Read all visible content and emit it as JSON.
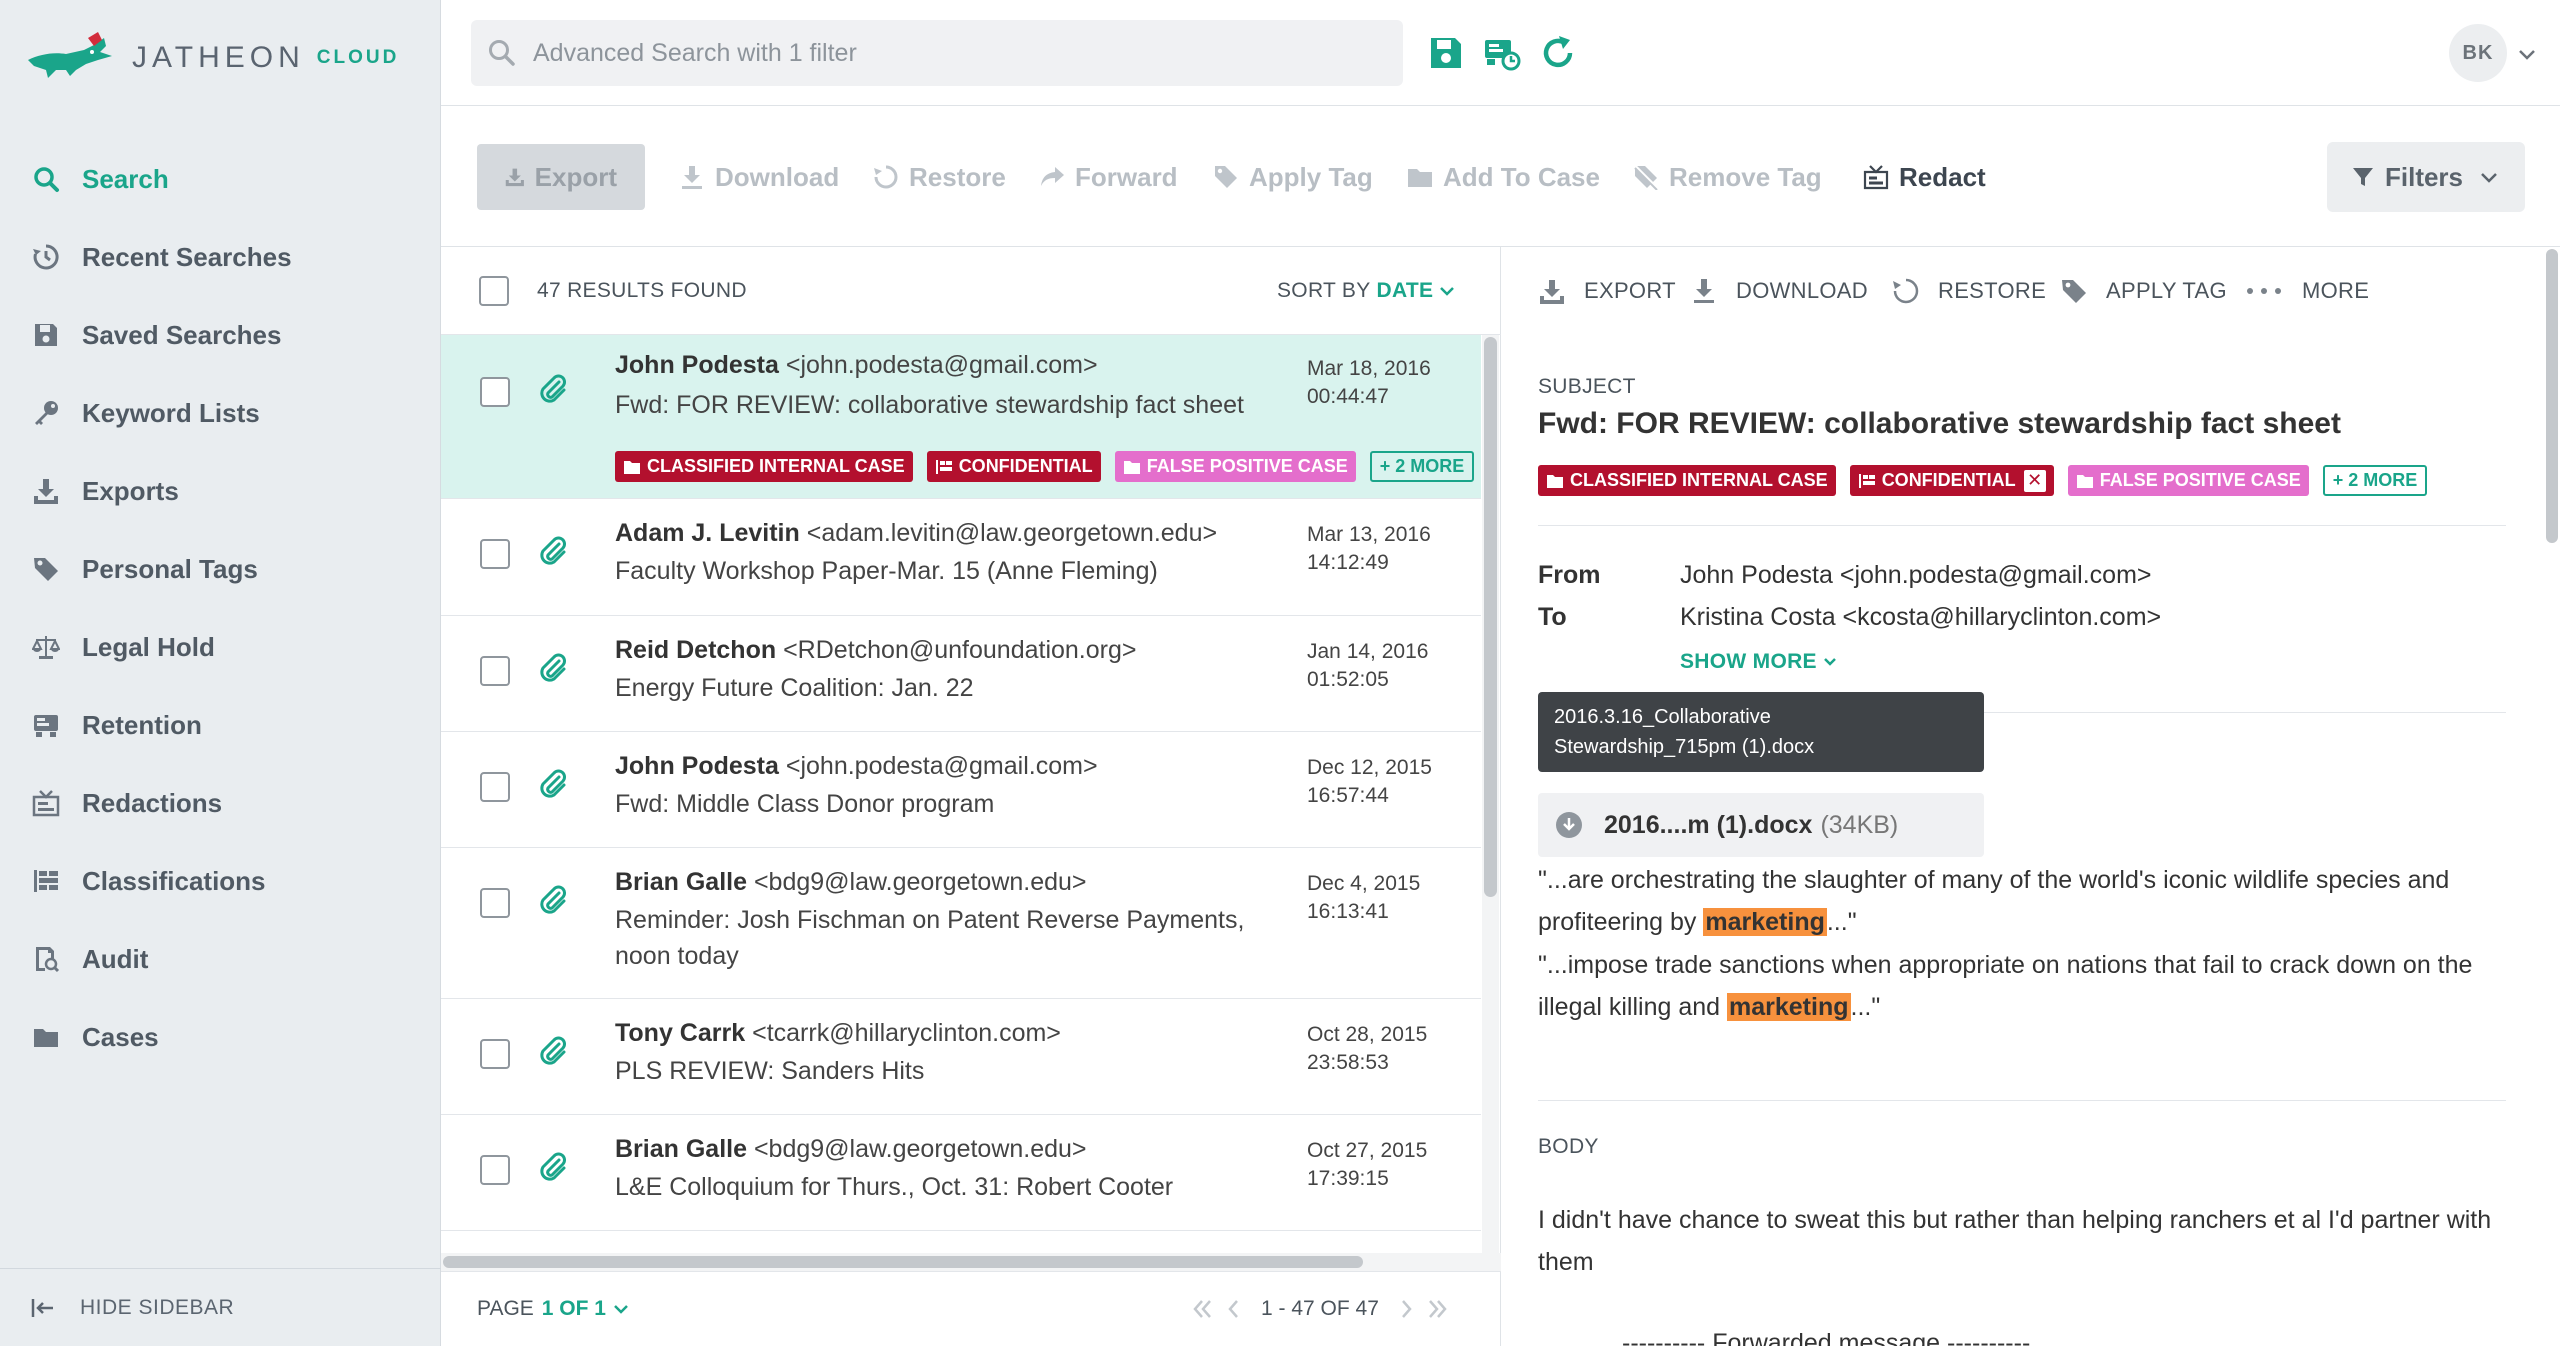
{
  "app": {
    "logo_text": "JATHEON",
    "logo_cloud": "CLOUD",
    "brand_color": "#1aa58a"
  },
  "sidebar": {
    "items": [
      {
        "label": "Search",
        "icon": "search-icon",
        "active": true
      },
      {
        "label": "Recent Searches",
        "icon": "history-icon"
      },
      {
        "label": "Saved Searches",
        "icon": "save-icon"
      },
      {
        "label": "Keyword Lists",
        "icon": "key-icon"
      },
      {
        "label": "Exports",
        "icon": "download-icon"
      },
      {
        "label": "Personal Tags",
        "icon": "tag-icon"
      },
      {
        "label": "Legal Hold",
        "icon": "scale-icon"
      },
      {
        "label": "Retention",
        "icon": "retention-icon"
      },
      {
        "label": "Redactions",
        "icon": "redact-icon"
      },
      {
        "label": "Classifications",
        "icon": "classification-icon"
      },
      {
        "label": "Audit",
        "icon": "audit-icon"
      },
      {
        "label": "Cases",
        "icon": "folder-icon"
      }
    ],
    "hide_label": "HIDE SIDEBAR"
  },
  "topbar": {
    "search_placeholder": "Advanced Search with 1 filter",
    "avatar_initials": "BK"
  },
  "toolbar": {
    "export": "Export",
    "download": "Download",
    "restore": "Restore",
    "forward": "Forward",
    "apply_tag": "Apply Tag",
    "add_to_case": "Add To Case",
    "remove_tag": "Remove Tag",
    "redact": "Redact",
    "filters": "Filters"
  },
  "list": {
    "results_count": "47 RESULTS FOUND",
    "sort_label": "SORT BY",
    "sort_value": "DATE",
    "page_label": "PAGE",
    "page_value": "1 OF 1",
    "range": "1 - 47 OF 47",
    "rows": [
      {
        "name": "John Podesta",
        "email": "<john.podesta@gmail.com>",
        "subject": "Fwd: FOR REVIEW: collaborative stewardship fact sheet",
        "date": "Mar 18, 2016",
        "time": "00:44:47"
      },
      {
        "name": "Adam J. Levitin",
        "email": "<adam.levitin@law.georgetown.edu>",
        "subject": "Faculty Workshop Paper-Mar. 15 (Anne Fleming)",
        "date": "Mar 13, 2016",
        "time": "14:12:49"
      },
      {
        "name": "Reid Detchon",
        "email": "<RDetchon@unfoundation.org>",
        "subject": "Energy Future Coalition: Jan. 22",
        "date": "Jan 14, 2016",
        "time": "01:52:05"
      },
      {
        "name": "John Podesta",
        "email": "<john.podesta@gmail.com>",
        "subject": "Fwd: Middle Class Donor program",
        "date": "Dec 12, 2015",
        "time": "16:57:44"
      },
      {
        "name": "Brian Galle",
        "email": "<bdg9@law.georgetown.edu>",
        "subject": "Reminder: Josh Fischman on Patent Reverse Payments, noon today",
        "date": "Dec 4, 2015",
        "time": "16:13:41"
      },
      {
        "name": "Tony Carrk",
        "email": "<tcarrk@hillaryclinton.com>",
        "subject": "PLS REVIEW: Sanders Hits",
        "date": "Oct 28, 2015",
        "time": "23:58:53"
      },
      {
        "name": "Brian Galle",
        "email": "<bdg9@law.georgetown.edu>",
        "subject": "L&E Colloquium for Thurs., Oct. 31: Robert Cooter",
        "date": "Oct 27, 2015",
        "time": "17:39:15"
      }
    ],
    "row0_tags": {
      "t1": "CLASSIFIED INTERNAL CASE",
      "t2": "CONFIDENTIAL",
      "t3": "FALSE POSITIVE CASE",
      "more": "+ 2 MORE"
    }
  },
  "detail": {
    "toolbar": {
      "export": "EXPORT",
      "download": "DOWNLOAD",
      "restore": "RESTORE",
      "apply_tag": "APPLY TAG",
      "more": "MORE"
    },
    "subject_label": "SUBJECT",
    "subject": "Fwd: FOR REVIEW: collaborative stewardship fact sheet",
    "tags": {
      "t1": "CLASSIFIED INTERNAL CASE",
      "t2": "CONFIDENTIAL",
      "t3": "FALSE POSITIVE CASE",
      "more": "+ 2 MORE"
    },
    "from_label": "From",
    "from_value": "John Podesta <john.podesta@gmail.com>",
    "to_label": "To",
    "to_value": "Kristina Costa <kcosta@hillaryclinton.com>",
    "show_more": "SHOW MORE",
    "tooltip_line1": "2016.3.16_Collaborative",
    "tooltip_line2": "Stewardship_715pm (1).docx",
    "attachment_name": "2016....m (1).docx",
    "attachment_size": "(34KB)",
    "snippet1_a": "\"...are orchestrating the slaughter of many of the world's iconic wildlife species and profiteering by ",
    "snippet1_hl": "marketing",
    "snippet1_b": "...\"",
    "snippet2_a": "\"...impose trade sanctions when appropriate on nations that fail to crack down on the illegal killing and ",
    "snippet2_hl": "marketing",
    "snippet2_b": "...\"",
    "body_label": "BODY",
    "body_text": "I didn't have chance to sweat this but rather than helping ranchers et al I'd partner with them",
    "body_fwd": "---------- Forwarded message ----------"
  }
}
